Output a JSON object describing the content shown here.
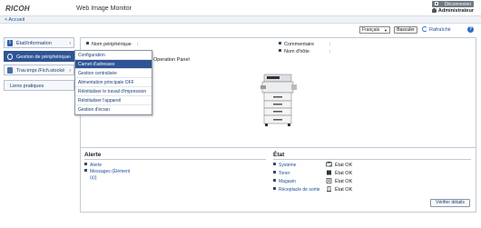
{
  "header": {
    "app_title": "Web Image Monitor",
    "logout_label": "Déconnexion",
    "user_name": "Administrateur"
  },
  "nav": {
    "home_link": "< Accueil"
  },
  "toolbar": {
    "language": "Français",
    "switch_label": "Basculer",
    "refresh_label": "Rafraîchir",
    "help_icon": "?"
  },
  "sidebar": {
    "items": [
      {
        "label": "État/Information",
        "icon": "info-icon"
      },
      {
        "label": "Gestion de périphérique",
        "icon": "gear-icon"
      },
      {
        "label": "Trav.impr./Fich.stocké",
        "icon": "document-icon"
      },
      {
        "label": "Liens pratiques"
      }
    ],
    "chevron": "›"
  },
  "dropdown": {
    "items": [
      "Configuration",
      "Carnet d'adresses",
      "Gestion centralisée",
      "Alimentation principale OFF",
      "Réinitialiser le travail d'impression",
      "Réinitialiser l'appareil",
      "Gestion d'écran"
    ]
  },
  "device_info": {
    "name_label": "Nom périphérique",
    "operation_panel": "Operation Panel",
    "comment_label": "Commentaire",
    "host_label": "Nom d'hôte",
    "colon": ":"
  },
  "alert": {
    "title": "Alerte",
    "items": [
      "Alerte",
      "Messages (Élément",
      "(s))"
    ]
  },
  "status": {
    "title": "État",
    "items": [
      {
        "label": "Système",
        "value": "État OK"
      },
      {
        "label": "Toner",
        "value": "État OK"
      },
      {
        "label": "Magasin",
        "value": "État OK"
      },
      {
        "label": "Réceptacle de sortie",
        "value": "État OK"
      }
    ],
    "details_button": "Vérifier détails"
  }
}
